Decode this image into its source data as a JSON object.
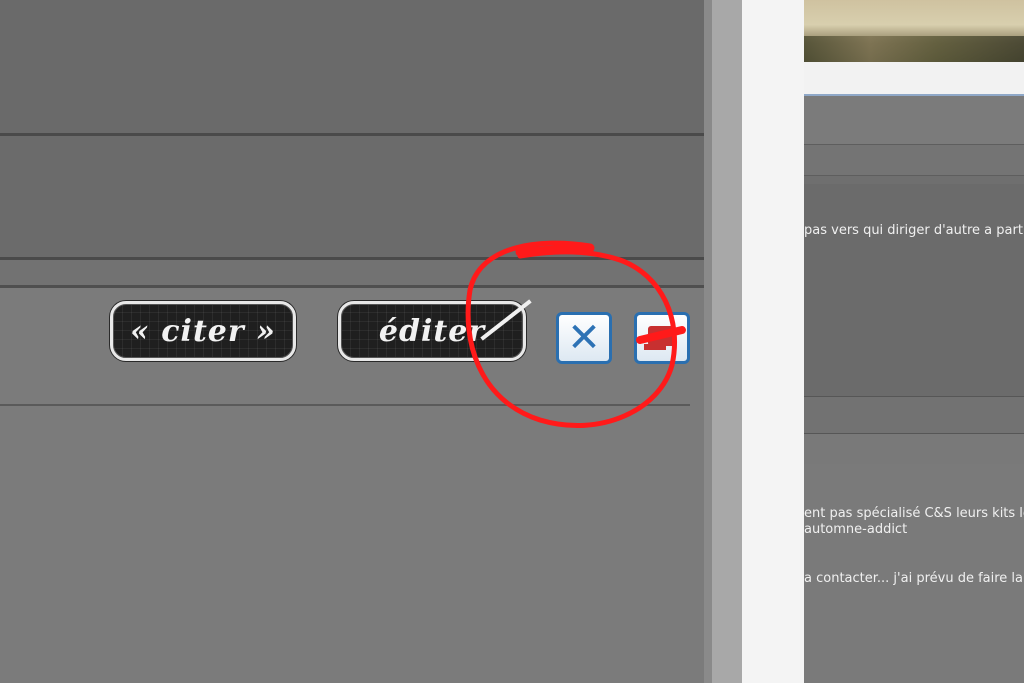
{
  "post_actions": {
    "quote_label": "« citer »",
    "edit_label": "éditer",
    "delete_icon": "close-icon",
    "report_icon": "report-icon"
  },
  "right_preview": {
    "line1": "pas vers qui diriger d'autre a part",
    "line2": "ent pas spécialisé C&S leurs kits le",
    "line3": "automne-addict",
    "line4": "a contacter... j'ai prévu de faire la p"
  },
  "colors": {
    "annotation": "#ff0000",
    "icon_blue": "#2d72b5"
  }
}
